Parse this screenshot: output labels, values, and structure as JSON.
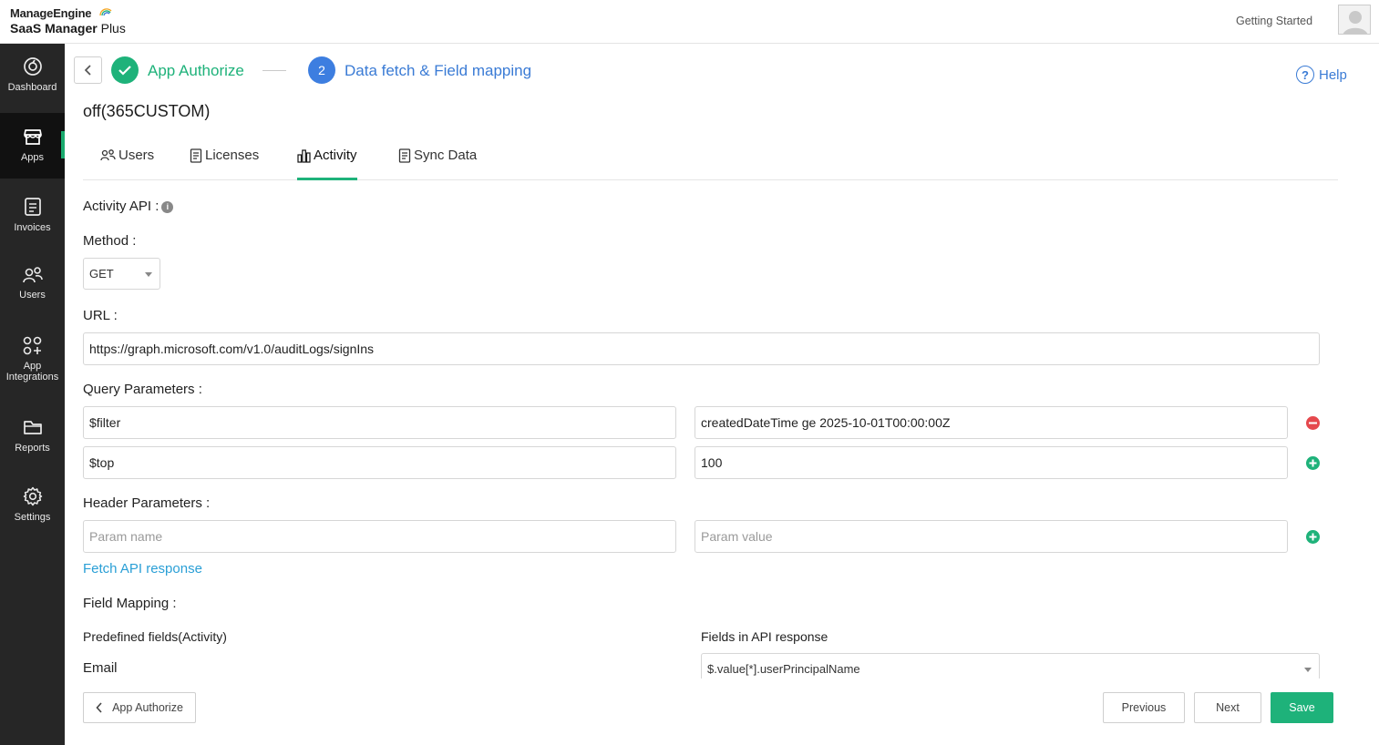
{
  "brand": {
    "line1": "ManageEngine",
    "line2_bold": "SaaS Manager",
    "line2_rest": " Plus"
  },
  "header": {
    "getting_started": "Getting Started"
  },
  "sidebar": {
    "items": [
      {
        "label": "Dashboard",
        "icon": "dashboard-icon"
      },
      {
        "label": "Apps",
        "icon": "store-icon"
      },
      {
        "label": "Invoices",
        "icon": "invoice-icon"
      },
      {
        "label": "Users",
        "icon": "users-icon"
      },
      {
        "label": "App",
        "label2": "Integrations",
        "icon": "integrations-icon"
      },
      {
        "label": "Reports",
        "icon": "folder-icon"
      },
      {
        "label": "Settings",
        "icon": "gear-icon"
      }
    ],
    "active": "Apps"
  },
  "wizard": {
    "step1_label": "App Authorize",
    "step2_number": "2",
    "step2_label": "Data fetch & Field mapping",
    "help_label": "Help"
  },
  "app_title": "off(365CUSTOM)",
  "tabs": [
    {
      "label": "Users",
      "icon": "users-icon"
    },
    {
      "label": "Licenses",
      "icon": "document-icon"
    },
    {
      "label": "Activity",
      "icon": "bar-chart-icon"
    },
    {
      "label": "Sync Data",
      "icon": "document-icon"
    }
  ],
  "active_tab": "Activity",
  "form": {
    "activity_api_label": "Activity API :",
    "method_label": "Method :",
    "method_value": "GET",
    "url_label": "URL :",
    "url_value": "https://graph.microsoft.com/v1.0/auditLogs/signIns",
    "query_label": "Query Parameters :",
    "query_params": [
      {
        "name": "$filter",
        "value": "createdDateTime ge 2025-10-01T00:00:00Z"
      },
      {
        "name": "$top",
        "value": "100"
      }
    ],
    "header_label": "Header Parameters :",
    "header_name_placeholder": "Param name",
    "header_value_placeholder": "Param value",
    "fetch_link": "Fetch API response",
    "field_mapping_label": "Field Mapping :",
    "predefined_head": "Predefined fields(Activity)",
    "api_fields_head": "Fields in API response",
    "mapping": [
      {
        "field": "Email",
        "api_value": "$.value[*].userPrincipalName"
      }
    ]
  },
  "footer": {
    "back_label": "App Authorize",
    "previous_label": "Previous",
    "next_label": "Next",
    "save_label": "Save"
  },
  "colors": {
    "accent_green": "#1eb27a",
    "accent_blue": "#3a7bd5",
    "link_blue": "#2a9fd6",
    "sidebar_bg": "#262626",
    "danger": "#e5484d"
  }
}
